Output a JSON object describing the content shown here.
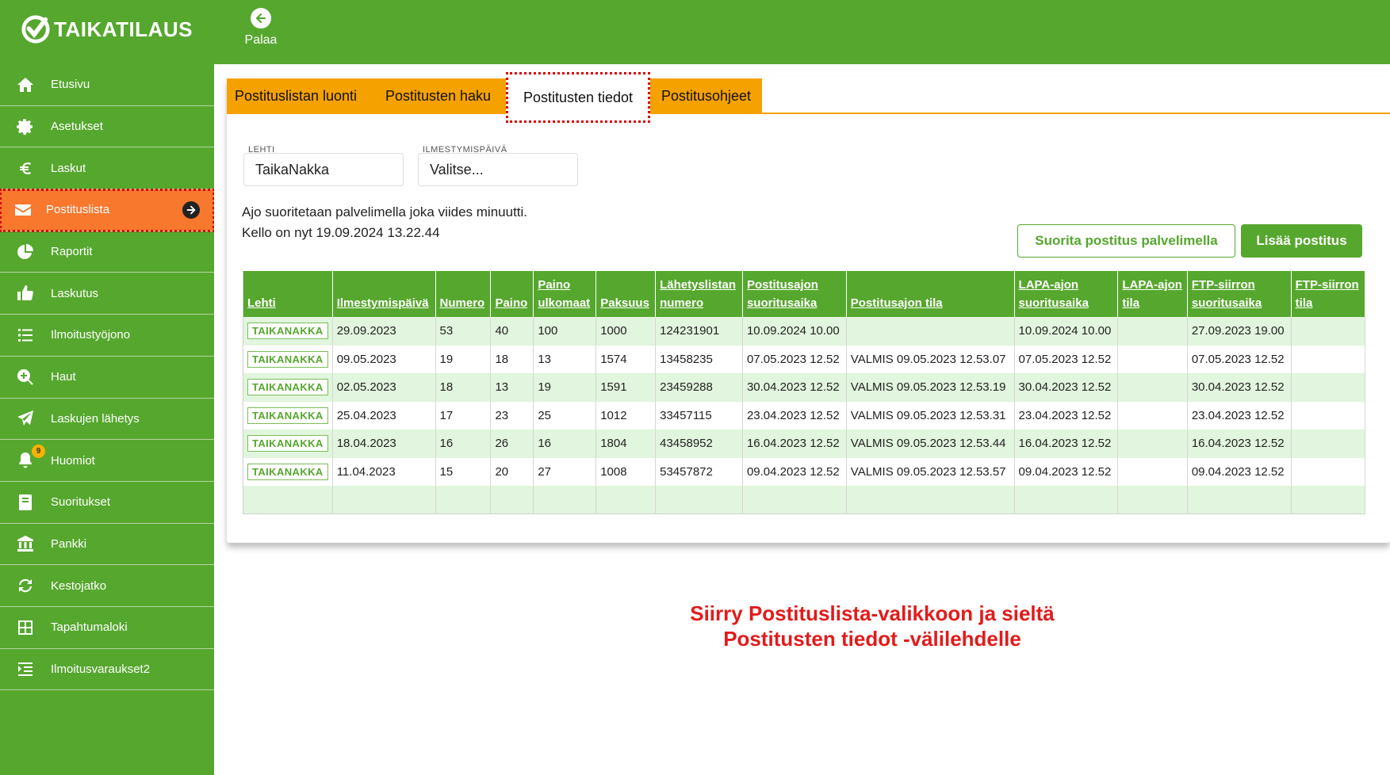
{
  "header": {
    "logo_text": "TAIKATILAUS",
    "back_label": "Palaa"
  },
  "sidebar": {
    "items": [
      {
        "label": "Etusivu",
        "icon": "home-icon"
      },
      {
        "label": "Asetukset",
        "icon": "gear-icon"
      },
      {
        "label": "Laskut",
        "icon": "euro-icon"
      },
      {
        "label": "Postituslista",
        "icon": "envelope-icon",
        "active": true
      },
      {
        "label": "Raportit",
        "icon": "pie-chart-icon"
      },
      {
        "label": "Laskutus",
        "icon": "thumbs-up-icon"
      },
      {
        "label": "Ilmoitustyöjono",
        "icon": "list-icon"
      },
      {
        "label": "Haut",
        "icon": "search-plus-icon"
      },
      {
        "label": "Laskujen lähetys",
        "icon": "paper-plane-icon"
      },
      {
        "label": "Huomiot",
        "icon": "bell-icon",
        "badge": "9"
      },
      {
        "label": "Suoritukset",
        "icon": "book-icon"
      },
      {
        "label": "Pankki",
        "icon": "bank-icon"
      },
      {
        "label": "Kestojatko",
        "icon": "refresh-icon"
      },
      {
        "label": "Tapahtumaloki",
        "icon": "grid-icon"
      },
      {
        "label": "Ilmoitusvaraukset2",
        "icon": "indent-list-icon"
      }
    ]
  },
  "tabs": [
    {
      "label": "Postituslistan luonti"
    },
    {
      "label": "Postitusten haku"
    },
    {
      "label": "Postitusten tiedot",
      "active": true
    },
    {
      "label": "Postitusohjeet"
    }
  ],
  "filters": {
    "lehti_label": "LEHTI",
    "lehti_value": "TaikaNakka",
    "date_label": "ILMESTYMISPÄIVÄ",
    "date_value": "Valitse..."
  },
  "info": {
    "line1": "Ajo suoritetaan palvelimella joka viides minuutti.",
    "line2": "Kello on nyt 19.09.2024 13.22.44"
  },
  "buttons": {
    "run_on_server": "Suorita postitus palvelimella",
    "add_mailing": "Lisää postitus"
  },
  "table": {
    "columns": [
      "Lehti",
      "Ilmestymispäivä",
      "Numero",
      "Paino",
      "Paino ulkomaat",
      "Paksuus",
      "Lähetyslistan numero",
      "Postitusajon suoritusaika",
      "Postitusajon tila",
      "LAPA-ajon suoritusaika",
      "LAPA-ajon tila",
      "FTP-siirron suoritusaika",
      "FTP-siirron tila"
    ],
    "rows": [
      [
        "TAIKANAKKA",
        "29.09.2023",
        "53",
        "40",
        "100",
        "1000",
        "124231901",
        "10.09.2024 10.00",
        "",
        "10.09.2024 10.00",
        "",
        "27.09.2023 19.00",
        ""
      ],
      [
        "TAIKANAKKA",
        "09.05.2023",
        "19",
        "18",
        "13",
        "1574",
        "13458235",
        "07.05.2023 12.52",
        "VALMIS 09.05.2023 12.53.07",
        "07.05.2023 12.52",
        "",
        "07.05.2023 12.52",
        ""
      ],
      [
        "TAIKANAKKA",
        "02.05.2023",
        "18",
        "13",
        "19",
        "1591",
        "23459288",
        "30.04.2023 12.52",
        "VALMIS 09.05.2023 12.53.19",
        "30.04.2023 12.52",
        "",
        "30.04.2023 12.52",
        ""
      ],
      [
        "TAIKANAKKA",
        "25.04.2023",
        "17",
        "23",
        "25",
        "1012",
        "33457115",
        "23.04.2023 12.52",
        "VALMIS 09.05.2023 12.53.31",
        "23.04.2023 12.52",
        "",
        "23.04.2023 12.52",
        ""
      ],
      [
        "TAIKANAKKA",
        "18.04.2023",
        "16",
        "26",
        "16",
        "1804",
        "43458952",
        "16.04.2023 12.52",
        "VALMIS 09.05.2023 12.53.44",
        "16.04.2023 12.52",
        "",
        "16.04.2023 12.52",
        ""
      ],
      [
        "TAIKANAKKA",
        "11.04.2023",
        "15",
        "20",
        "27",
        "1008",
        "53457872",
        "09.04.2023 12.52",
        "VALMIS 09.05.2023 12.53.57",
        "09.04.2023 12.52",
        "",
        "09.04.2023 12.52",
        ""
      ]
    ]
  },
  "instruction": {
    "line1": "Siirry Postituslista-valikkoon ja sieltä",
    "line2": "Postitusten tiedot -välilehdelle"
  },
  "colors": {
    "brand_green": "#56a72e",
    "tab_orange": "#f5a100",
    "active_orange": "#f8782e",
    "highlight_red": "#d90000"
  }
}
